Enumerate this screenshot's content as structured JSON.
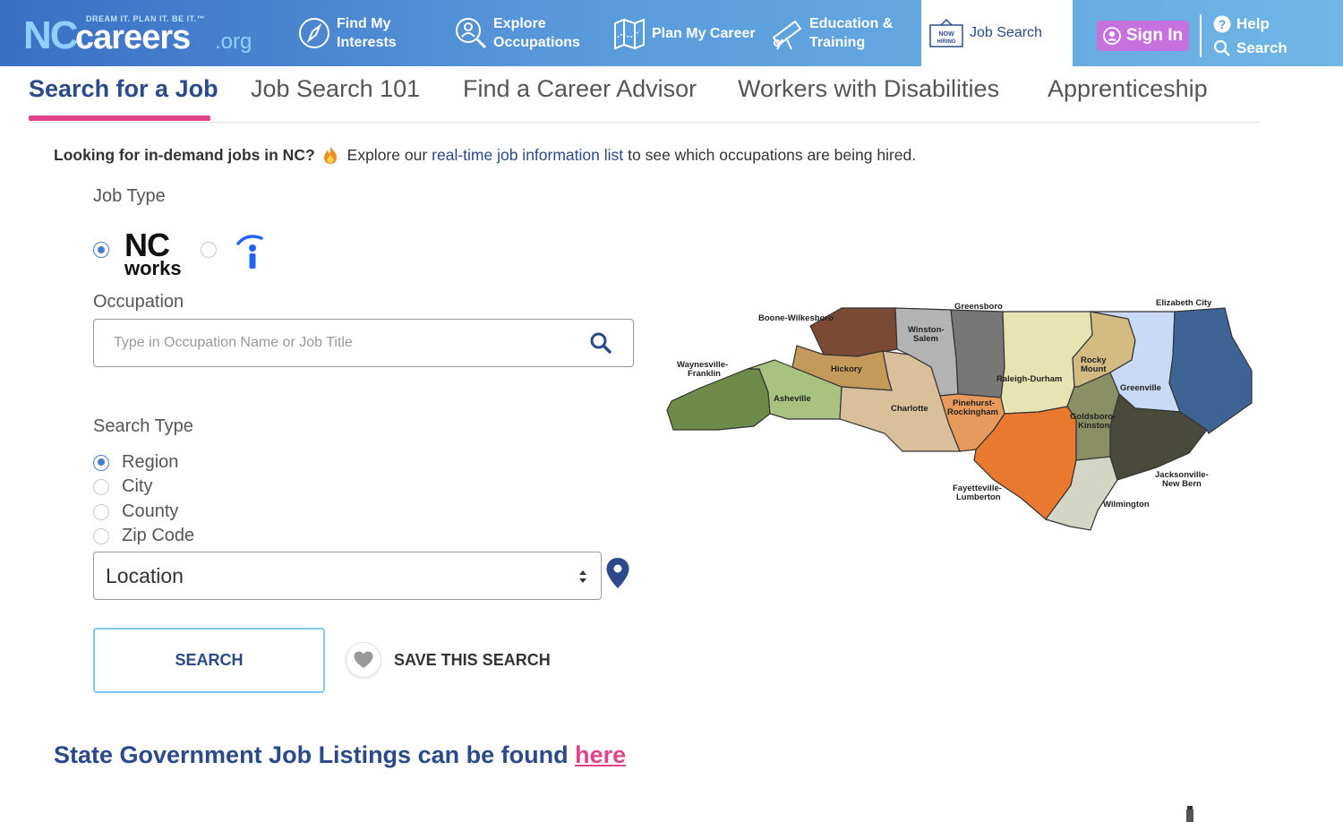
{
  "header": {
    "logo": {
      "tagline": "DREAM IT. PLAN IT. BE IT.™",
      "nc": "NC",
      "careers": "careers",
      "org": ".org"
    },
    "nav": [
      {
        "label": "Find My Interests",
        "icon": "compass-icon"
      },
      {
        "label": "Explore Occupations",
        "icon": "magnifier-person-icon"
      },
      {
        "label": "Plan My Career",
        "icon": "map-icon"
      },
      {
        "label": "Education & Training",
        "icon": "telescope-icon"
      },
      {
        "label": "Job Search",
        "icon": "now-hiring-sign-icon"
      }
    ],
    "hiring_sign": "NOW HIRING",
    "sign_in": "Sign In",
    "help": "Help",
    "search": "Search"
  },
  "subtabs": [
    {
      "label": "Search for a Job",
      "active": true
    },
    {
      "label": "Job Search 101"
    },
    {
      "label": "Find a Career Advisor"
    },
    {
      "label": "Workers with Disabilities"
    },
    {
      "label": "Apprenticeship"
    }
  ],
  "promo": {
    "lead": "Looking for in-demand jobs in NC?",
    "text_before": "Explore our",
    "link": "real-time job information list",
    "text_after": "to see which occupations are being hired."
  },
  "job_type": {
    "label": "Job Type",
    "options": [
      {
        "name": "NCWorks",
        "nc": "NC",
        "works": "works",
        "selected": true
      },
      {
        "name": "Indeed",
        "selected": false
      }
    ]
  },
  "occupation": {
    "label": "Occupation",
    "placeholder": "Type in Occupation Name or Job Title",
    "value": ""
  },
  "search_type": {
    "label": "Search Type",
    "options": [
      {
        "label": "Region",
        "selected": true
      },
      {
        "label": "City",
        "selected": false
      },
      {
        "label": "County",
        "selected": false
      },
      {
        "label": "Zip Code",
        "selected": false
      }
    ]
  },
  "location": {
    "selected": "Location"
  },
  "actions": {
    "search": "SEARCH",
    "save": "SAVE THIS SEARCH"
  },
  "state_gov": {
    "text": "State Government Job Listings can be found",
    "link": "here"
  },
  "map": {
    "regions": [
      {
        "name": "Waynesville-Franklin",
        "line1": "Waynesville-",
        "line2": "Franklin",
        "color": "#6e8b4a"
      },
      {
        "name": "Asheville",
        "line1": "Asheville",
        "color": "#a8c380"
      },
      {
        "name": "Boone-Wilkesboro",
        "line1": "Boone-Wilkesboro",
        "color": "#7a4a34"
      },
      {
        "name": "Hickory",
        "line1": "Hickory",
        "color": "#c49a5a"
      },
      {
        "name": "Charlotte",
        "line1": "Charlotte",
        "color": "#d9c09a"
      },
      {
        "name": "Winston-Salem",
        "line1": "Winston-",
        "line2": "Salem",
        "color": "#b3b3b3"
      },
      {
        "name": "Greensboro",
        "line1": "Greensboro",
        "color": "#777777"
      },
      {
        "name": "Pinehurst-Rockingham",
        "line1": "Pinehurst-",
        "line2": "Rockingham",
        "color": "#e89a5c"
      },
      {
        "name": "Raleigh-Durham",
        "line1": "Raleigh-Durham",
        "color": "#e8e3b2"
      },
      {
        "name": "Fayetteville-Lumberton",
        "line1": "Fayetteville-",
        "line2": "Lumberton",
        "color": "#e8792e"
      },
      {
        "name": "Rocky Mount",
        "line1": "Rocky",
        "line2": "Mount",
        "color": "#d4bb82"
      },
      {
        "name": "Goldsboro-Kinston",
        "line1": "Goldsboro-",
        "line2": "Kinston",
        "color": "#8a8f66"
      },
      {
        "name": "Wilmington",
        "line1": "Wilmington",
        "color": "#d3d6c4"
      },
      {
        "name": "Greenville",
        "line1": "Greenville",
        "color": "#c8daf5"
      },
      {
        "name": "Jacksonville-New Bern",
        "line1": "Jacksonville-",
        "line2": "New Bern",
        "color": "#4a4a3c"
      },
      {
        "name": "Elizabeth City",
        "line1": "Elizabeth City",
        "color": "#3d6494"
      }
    ]
  },
  "colors": {
    "brand_blue": "#2c4a8a",
    "accent_pink": "#e0458c",
    "sign_in": "#c770e0",
    "search_border": "#7ec9ee"
  }
}
